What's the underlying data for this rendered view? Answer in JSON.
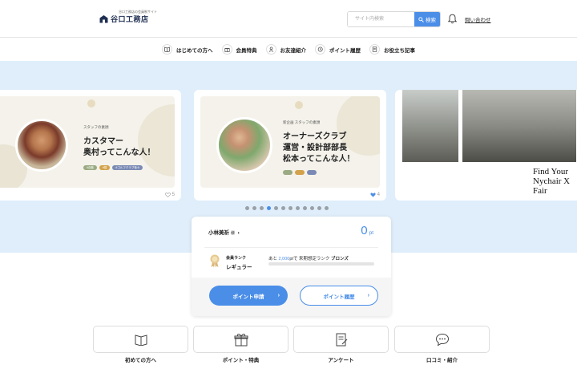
{
  "header": {
    "logo_sub": "谷口工務店の会員制サイト",
    "logo_name": "谷口工務店",
    "search_placeholder": "サイト内検索",
    "search_button": "検索",
    "contact_link": "問い合わせ"
  },
  "nav": [
    {
      "label": "はじめての方へ",
      "icon": "book-icon"
    },
    {
      "label": "会員特典",
      "icon": "gift-icon"
    },
    {
      "label": "お友達紹介",
      "icon": "person-icon"
    },
    {
      "label": "ポイント履歴",
      "icon": "history-icon"
    },
    {
      "label": "お役立ち記事",
      "icon": "article-icon"
    }
  ],
  "cards": [
    {
      "tag": "スタッフの素顔",
      "title_line1": "カスタマー",
      "title_line2": "奥村ってこんな人！",
      "pills": [
        "#自動",
        "#猫",
        "#ゴルフクラブ後々"
      ],
      "likes": "5"
    },
    {
      "tag": "新企画 スタッフの素顔",
      "title_line1": "オーナーズクラブ",
      "title_line2": "運営・設計部部長",
      "title_line3": "松本ってこんな人！",
      "likes": "4"
    },
    {
      "caption_line1": "Find Your",
      "caption_line2": "Nychair X",
      "caption_line3": "Fair"
    }
  ],
  "carousel": {
    "count": 12,
    "active": 3
  },
  "points_panel": {
    "user_name": "小林美祈",
    "user_suffix": "様",
    "points_value": "0",
    "points_unit": "pt",
    "rank_label": "会員ランク",
    "rank_value": "レギュラー",
    "next_prefix": "あと",
    "next_points": "2,000",
    "next_mid": "ptで 来期想定ランク",
    "next_rank": "ブロンズ",
    "progress": 0,
    "apply_button": "ポイント申請",
    "history_button": "ポイント履歴"
  },
  "quick_links": [
    {
      "label": "初めての方へ",
      "icon": "book-icon"
    },
    {
      "label": "ポイント・特典",
      "icon": "gift-icon"
    },
    {
      "label": "アンケート",
      "icon": "survey-icon"
    },
    {
      "label": "口コミ・紹介",
      "icon": "chat-icon"
    }
  ],
  "colors": {
    "accent": "#4a8ee8",
    "band": "#dfeefa",
    "navy": "#1f2f52"
  }
}
